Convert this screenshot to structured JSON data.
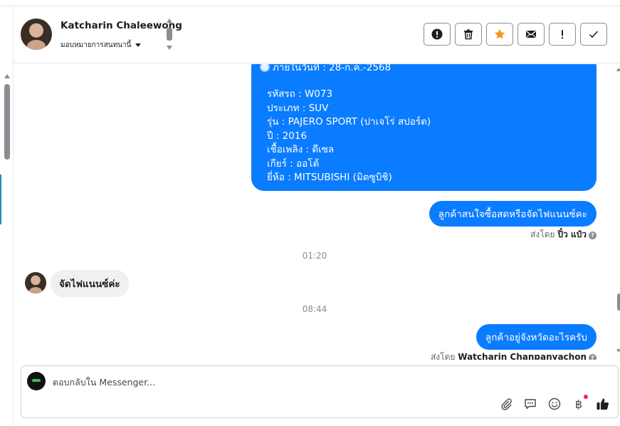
{
  "header": {
    "contact_name": "Katcharin Chaleewong",
    "assign_label": "มอบหมายการสนทนานี้"
  },
  "actions": [
    {
      "name": "report-spam-button",
      "icon": "alert-circle-icon"
    },
    {
      "name": "delete-button",
      "icon": "trash-icon"
    },
    {
      "name": "star-button",
      "icon": "star-icon"
    },
    {
      "name": "mark-unread-button",
      "icon": "envelope-icon"
    },
    {
      "name": "important-button",
      "icon": "exclamation-icon"
    },
    {
      "name": "mark-done-button",
      "icon": "check-icon"
    }
  ],
  "messages": {
    "big_bubble": {
      "deadline": "ภายในวันที่ : 28-ก.ค.-2568",
      "lines": [
        "รหัสรถ : W073",
        "ประเภท : SUV",
        "รุ่น : PAJERO SPORT (ปาเจโร่ สปอร์ต)",
        "ปี : 2016",
        "เชื้อเพลิง : ดีเซล",
        "เกียร์ : ออโต้",
        "ยี่ห้อ : MITSUBISHI (มิตซูบิชิ)"
      ]
    },
    "out_1": "ลูกค้าสนใจซื้อสดหรือจัดไฟแนนซ์คะ",
    "sent_by_prefix": "ส่งโดย",
    "sent_by_1": "ปิ๋ว แป๋ว",
    "time_1": "01:20",
    "in_1": "จัดไฟแนนซ์ค่ะ",
    "time_2": "08:44",
    "out_2": "ลูกค้าอยู่จังหวัดอะไรครับ",
    "sent_by_2": "Watcharin Chanpanyachon"
  },
  "composer": {
    "placeholder": "ตอบกลับใน Messenger...",
    "tools": [
      "paperclip-icon",
      "saved-reply-icon",
      "emoji-icon",
      "payment-icon",
      "like-icon"
    ],
    "payment_glyph": "฿"
  },
  "colors": {
    "outgoing_bubble": "#0a7cff",
    "incoming_bubble": "#f0f0f0",
    "star": "#f7931e",
    "notification_dot": "#f02849"
  }
}
